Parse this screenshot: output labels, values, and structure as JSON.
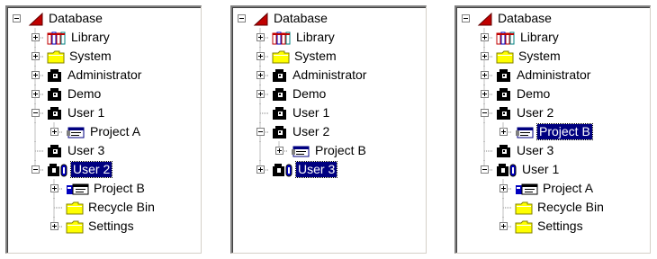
{
  "panels": [
    {
      "rows": [
        {
          "label": "Database",
          "depth": 0,
          "exp": "minus",
          "icon": "database-icon",
          "line": "none"
        },
        {
          "label": "Library",
          "depth": 1,
          "exp": "plus",
          "icon": "books-icon",
          "line": "tee"
        },
        {
          "label": "System",
          "depth": 1,
          "exp": "plus",
          "icon": "folder-icon",
          "line": "tee"
        },
        {
          "label": "Administrator",
          "depth": 1,
          "exp": "plus",
          "icon": "user-icon",
          "line": "tee"
        },
        {
          "label": "Demo",
          "depth": 1,
          "exp": "plus",
          "icon": "user-icon",
          "line": "tee"
        },
        {
          "label": "User 1",
          "depth": 1,
          "exp": "minus",
          "icon": "user-icon",
          "line": "tee"
        },
        {
          "label": "Project A",
          "depth": 2,
          "exp": "plus",
          "icon": "project-icon",
          "line": "corner"
        },
        {
          "label": "User 3",
          "depth": 1,
          "exp": "none",
          "icon": "user-icon",
          "line": "tee"
        },
        {
          "label": "User 2",
          "depth": 1,
          "exp": "minus",
          "icon": "user-active-icon",
          "line": "corner",
          "selected": true
        },
        {
          "label": "Project B",
          "depth": 2,
          "exp": "plus",
          "icon": "project-active-icon",
          "line": "tee"
        },
        {
          "label": "Recycle Bin",
          "depth": 2,
          "exp": "none",
          "icon": "folder-icon",
          "line": "tee"
        },
        {
          "label": "Settings",
          "depth": 2,
          "exp": "plus",
          "icon": "folder-icon",
          "line": "corner"
        }
      ]
    },
    {
      "rows": [
        {
          "label": "Database",
          "depth": 0,
          "exp": "minus",
          "icon": "database-icon",
          "line": "none"
        },
        {
          "label": "Library",
          "depth": 1,
          "exp": "plus",
          "icon": "books-icon",
          "line": "tee"
        },
        {
          "label": "System",
          "depth": 1,
          "exp": "plus",
          "icon": "folder-icon",
          "line": "tee"
        },
        {
          "label": "Administrator",
          "depth": 1,
          "exp": "plus",
          "icon": "user-icon",
          "line": "tee"
        },
        {
          "label": "Demo",
          "depth": 1,
          "exp": "plus",
          "icon": "user-icon",
          "line": "tee"
        },
        {
          "label": "User 1",
          "depth": 1,
          "exp": "none",
          "icon": "user-icon",
          "line": "tee"
        },
        {
          "label": "User 2",
          "depth": 1,
          "exp": "minus",
          "icon": "user-icon",
          "line": "tee"
        },
        {
          "label": "Project B",
          "depth": 2,
          "exp": "plus",
          "icon": "project-icon",
          "line": "corner"
        },
        {
          "label": "User 3",
          "depth": 1,
          "exp": "plus",
          "icon": "user-active-icon",
          "line": "corner",
          "selected": true
        }
      ]
    },
    {
      "rows": [
        {
          "label": "Database",
          "depth": 0,
          "exp": "minus",
          "icon": "database-icon",
          "line": "none"
        },
        {
          "label": "Library",
          "depth": 1,
          "exp": "plus",
          "icon": "books-icon",
          "line": "tee"
        },
        {
          "label": "System",
          "depth": 1,
          "exp": "plus",
          "icon": "folder-icon",
          "line": "tee"
        },
        {
          "label": "Administrator",
          "depth": 1,
          "exp": "plus",
          "icon": "user-icon",
          "line": "tee"
        },
        {
          "label": "Demo",
          "depth": 1,
          "exp": "plus",
          "icon": "user-icon",
          "line": "tee"
        },
        {
          "label": "User 2",
          "depth": 1,
          "exp": "minus",
          "icon": "user-icon",
          "line": "tee"
        },
        {
          "label": "Project B",
          "depth": 2,
          "exp": "plus",
          "icon": "project-icon",
          "line": "corner",
          "selected": true
        },
        {
          "label": "User 3",
          "depth": 1,
          "exp": "none",
          "icon": "user-icon",
          "line": "tee"
        },
        {
          "label": "User 1",
          "depth": 1,
          "exp": "minus",
          "icon": "user-active-icon",
          "line": "corner"
        },
        {
          "label": "Project A",
          "depth": 2,
          "exp": "plus",
          "icon": "project-active-icon",
          "line": "tee"
        },
        {
          "label": "Recycle Bin",
          "depth": 2,
          "exp": "none",
          "icon": "folder-icon",
          "line": "tee"
        },
        {
          "label": "Settings",
          "depth": 2,
          "exp": "plus",
          "icon": "folder-icon",
          "line": "corner"
        }
      ]
    }
  ],
  "colors": {
    "selection": "#000080",
    "folder": "#ffff00",
    "books": "#c00000",
    "user": "#000000",
    "active": "#0000c0"
  }
}
